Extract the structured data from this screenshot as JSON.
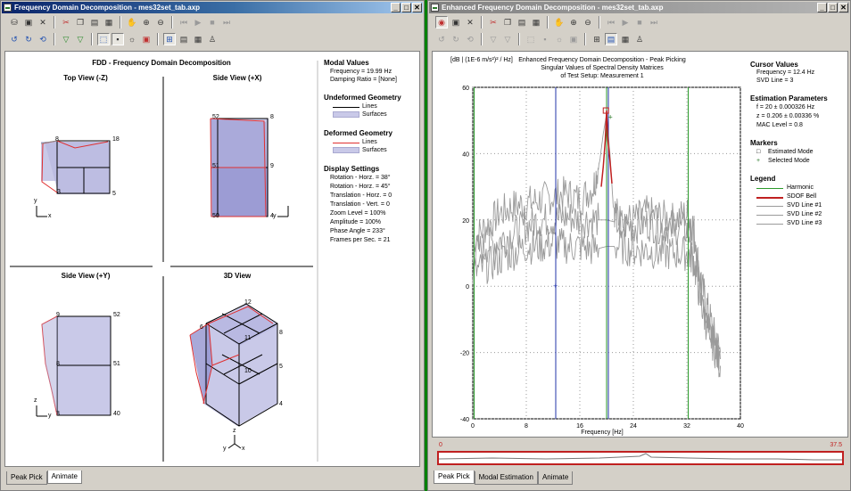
{
  "left_window": {
    "title": "Frequency Domain Decomposition - mes32set_tab.axp",
    "buttons": {
      "minimize": "_",
      "maximize": "□",
      "close": "✕"
    },
    "toolbar1_icons": [
      "open-icon",
      "save-icon",
      "close-x-icon",
      "cut-icon",
      "copy-icon",
      "paste-icon",
      "hand-icon",
      "zoom-in-icon",
      "zoom-out-icon",
      "first-icon",
      "play-icon",
      "stop-icon",
      "last-icon"
    ],
    "toolbar2_icons": [
      "rotate-left-icon",
      "rotate-right-icon",
      "reset-icon",
      "filter-icon",
      "filter2-icon",
      "select-icon",
      "grid-icon",
      "sun-icon",
      "view-icon",
      "split-icon",
      "list-icon",
      "bars-icon",
      "person-icon"
    ],
    "main_title": "FDD - Frequency Domain Decomposition",
    "views": {
      "top_view": "Top View (-Z)",
      "side_view_x": "Side View (+X)",
      "side_view_y": "Side View (+Y)",
      "view_3d": "3D View"
    },
    "node_labels": {
      "top": [
        "18",
        "5"
      ],
      "sidex": [
        "52",
        "8",
        "51",
        "9",
        "50",
        "4"
      ],
      "sidey": [
        "9",
        "52",
        "51",
        "40"
      ],
      "d3": [
        "12",
        "6",
        "8",
        "11",
        "5",
        "4",
        "10"
      ]
    },
    "axes": {
      "y": "y",
      "x": "x",
      "z": "z"
    },
    "modal_values": {
      "title": "Modal Values",
      "frequency": "Frequency = 19.99 Hz",
      "damping": "Damping Ratio = [None]"
    },
    "undeformed": {
      "title": "Undeformed Geometry",
      "lines": "Lines",
      "surfaces": "Surfaces"
    },
    "deformed": {
      "title": "Deformed Geometry",
      "lines": "Lines",
      "surfaces": "Surfaces"
    },
    "display_settings": {
      "title": "Display Settings",
      "items": [
        "Rotation - Horz. = 38°",
        "Rotation - Horz. = 45°",
        "Translation - Horz. = 0",
        "Translation - Vert. = 0",
        "Zoom Level = 100%",
        "Amplitude = 100%",
        "Phase Angle = 233°",
        "Frames per Sec. = 21"
      ]
    },
    "tabs": [
      "Peak Pick",
      "Animate"
    ],
    "active_tab": "Animate"
  },
  "right_window": {
    "title": "Enhanced Frequency Domain Decomposition - mes32set_tab.axp",
    "buttons": {
      "minimize": "_",
      "maximize": "□",
      "close": "✕"
    },
    "chart_title_lines": [
      "Enhanced Frequency Domain Decomposition - Peak Picking",
      "Singular Values of Spectral Density Matrices",
      "of Test Setup: Measurement 1"
    ],
    "ylabel": "[dB | (1E-6 m/s²)² / Hz]",
    "xlabel": "Frequency [Hz]",
    "cursor_values": {
      "title": "Cursor Values",
      "frequency": "Frequency = 12.4 Hz",
      "svd_line": "SVD Line = 3"
    },
    "estimation": {
      "title": "Estimation Parameters",
      "f": "f = 20 ± 0.000326 Hz",
      "z": "z = 0.206 ± 0.00336 %",
      "mac": "MAC Level = 0.8"
    },
    "markers": {
      "title": "Markers",
      "estimated": "Estimated Mode",
      "selected": "Selected Mode"
    },
    "legend": {
      "title": "Legend",
      "items": [
        "Harmonic",
        "SDOF Bell",
        "SVD Line #1",
        "SVD Line #2",
        "SVD Line #3"
      ]
    },
    "range_labels": {
      "start": "0",
      "end": "37.5"
    },
    "tabs": [
      "Peak Pick",
      "Modal Estimation",
      "Animate"
    ],
    "active_tab": "Peak Pick"
  },
  "colors": {
    "harmonic": "#2a9a2a",
    "sdof": "#c02020",
    "svd": "#9a9a9a",
    "blue_line": "#2233aa"
  },
  "chart_data": {
    "type": "line",
    "title": "Enhanced Frequency Domain Decomposition - Peak Picking",
    "xlabel": "Frequency [Hz]",
    "ylabel": "[dB | (1E-6 m/s²)² / Hz]",
    "xlim": [
      0,
      40
    ],
    "ylim": [
      -40,
      60
    ],
    "xticks": [
      0,
      8,
      16,
      24,
      32,
      40
    ],
    "yticks": [
      -40,
      -20,
      0,
      20,
      40,
      60
    ],
    "grid": true,
    "vertical_lines": [
      {
        "name": "Harmonic",
        "x": [
          0.2,
          12.4,
          20.0,
          32.2
        ]
      },
      {
        "name": "Cursor",
        "x": 12.4
      },
      {
        "name": "Mode",
        "x": 20.0
      }
    ],
    "series": [
      {
        "name": "SVD Line #1",
        "x": [
          0,
          2,
          4,
          6,
          8,
          10,
          12,
          14,
          16,
          18,
          19,
          19.5,
          20,
          20.5,
          21,
          22,
          24,
          26,
          28,
          30,
          32,
          33,
          34,
          35,
          36,
          37
        ],
        "y": [
          14,
          18,
          22,
          24,
          25,
          26,
          27,
          28,
          26,
          30,
          38,
          46,
          52,
          40,
          24,
          20,
          20,
          22,
          21,
          20,
          22,
          18,
          2,
          -6,
          -14,
          -20
        ]
      },
      {
        "name": "SVD Line #2",
        "x": [
          0,
          2,
          4,
          6,
          8,
          10,
          12,
          14,
          16,
          18,
          20,
          22,
          24,
          26,
          28,
          30,
          32,
          33,
          34,
          35,
          36,
          37
        ],
        "y": [
          10,
          12,
          14,
          16,
          18,
          20,
          20,
          21,
          20,
          20,
          20,
          19,
          18,
          19,
          18,
          18,
          17,
          14,
          0,
          -8,
          -16,
          -22
        ]
      },
      {
        "name": "SVD Line #3",
        "x": [
          0,
          2,
          4,
          6,
          8,
          10,
          12,
          14,
          16,
          18,
          20,
          22,
          24,
          26,
          28,
          30,
          32,
          33,
          34,
          35,
          36,
          37
        ],
        "y": [
          4,
          6,
          8,
          10,
          12,
          12,
          13,
          12,
          12,
          11,
          12,
          12,
          11,
          11,
          10,
          10,
          10,
          8,
          -4,
          -12,
          -18,
          -24
        ]
      }
    ]
  }
}
